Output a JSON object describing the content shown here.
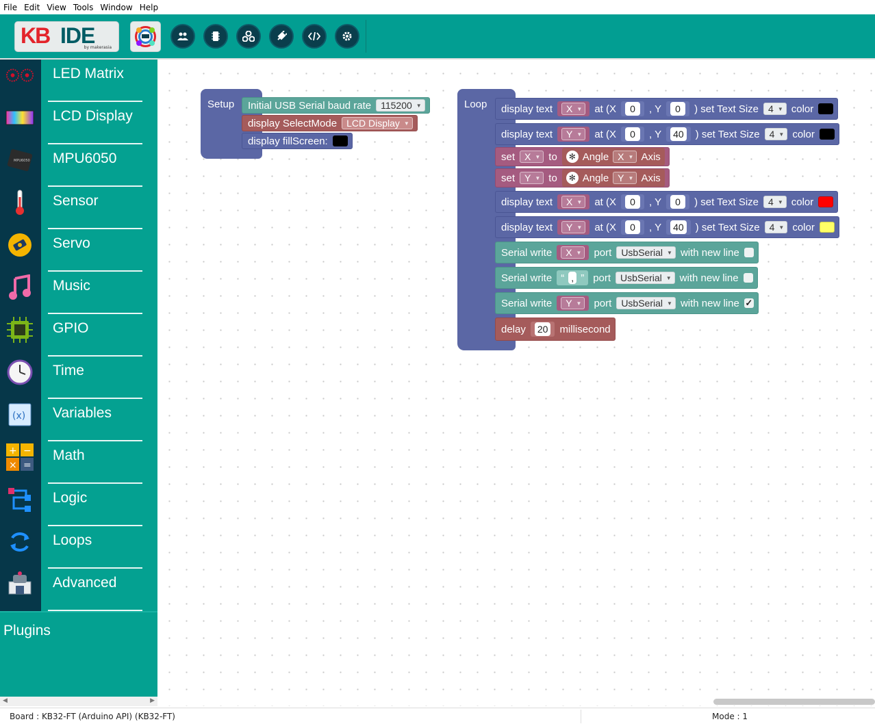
{
  "menu": [
    "File",
    "Edit",
    "View",
    "Tools",
    "Window",
    "Help"
  ],
  "toolbar": {
    "logo_kb": "KB",
    "logo_ide": "IDE",
    "logo_by": "by makerasia",
    "buttons": [
      "users-icon",
      "chip-icon",
      "network-icon",
      "plug-icon",
      "code-icon",
      "gear-icon"
    ]
  },
  "categories": [
    "LED Matrix",
    "LCD Display",
    "MPU6050",
    "Sensor",
    "Servo",
    "Music",
    "GPIO",
    "Time",
    "Variables",
    "Math",
    "Logic",
    "Loops",
    "Advanced"
  ],
  "plugins_label": "Plugins",
  "status": {
    "board": "Board : KB32-FT (Arduino API) (KB32-FT)",
    "mode": "Mode : 1"
  },
  "setup": {
    "label": "Setup",
    "baud_label": "Initial USB Serial baud rate",
    "baud_value": "115200",
    "selectmode_label": "display SelectMode",
    "selectmode_value": "LCD Display",
    "fill_label": "display fillScreen:",
    "fill_color": "#000000"
  },
  "loop": {
    "label": "Loop",
    "display_text": "display text",
    "at_x": "at (X",
    "comma_y": ", Y",
    "set_text_size": ") set Text Size",
    "color": "color",
    "set": "set",
    "to": "to",
    "angle": "Angle",
    "axis": "Axis",
    "serial_write": "Serial write",
    "port": "port",
    "usbserial": "UsbSerial",
    "with_new_line": "with new line",
    "comma_string": ",",
    "delay": "delay",
    "delay_value": "20",
    "millisecond": "millisecond",
    "var_x": "X",
    "var_y": "Y",
    "val_0": "0",
    "val_40": "40",
    "size_4": "4",
    "color_black": "#000000",
    "color_red": "#ff0000",
    "color_yellow": "#ffff66",
    "newline_checked": "✓"
  }
}
